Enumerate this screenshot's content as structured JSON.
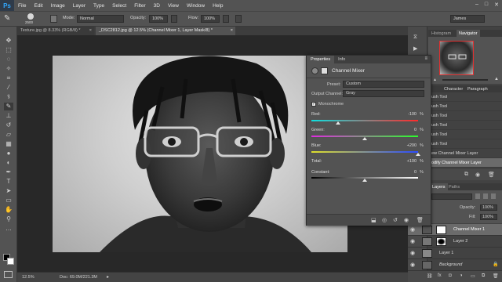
{
  "app": {
    "logo": "Ps",
    "user": "James"
  },
  "menu": [
    "File",
    "Edit",
    "Image",
    "Layer",
    "Type",
    "Select",
    "Filter",
    "3D",
    "View",
    "Window",
    "Help"
  ],
  "window_controls": [
    "–",
    "□",
    "✕"
  ],
  "options_bar": {
    "brush_size": "2500",
    "mode_label": "Mode:",
    "mode_value": "Normal",
    "opacity_label": "Opacity:",
    "opacity_value": "100%",
    "flow_label": "Flow:",
    "flow_value": "100%"
  },
  "tabs": [
    {
      "label": "Texture.jpg @ 8.33% (RGB/8) *",
      "close": "×"
    },
    {
      "label": "_DSC2812.jpg @ 12.5% (Channel Mixer 1, Layer Mask/8) *",
      "close": "×"
    }
  ],
  "status": {
    "zoom": "12.5%",
    "doc": "Doc: 69.0M/221.3M"
  },
  "properties": {
    "tabs": [
      "Properties",
      "Info"
    ],
    "title": "Channel Mixer",
    "preset_label": "Preset:",
    "preset_value": "Custom",
    "output_label": "Output Channel:",
    "output_value": "Gray",
    "monochrome_label": "Monochrome",
    "sliders": [
      {
        "label": "Red:",
        "value": "-100",
        "pos": 0.25,
        "track": "red"
      },
      {
        "label": "Green:",
        "value": "0",
        "pos": 0.5,
        "track": "green"
      },
      {
        "label": "Blue:",
        "value": "+200",
        "pos": 1.0,
        "track": "blue"
      }
    ],
    "total_label": "Total:",
    "total_value": "+100",
    "constant_label": "Constant:",
    "constant_value": "0",
    "constant_pos": 0.5,
    "pct": "%"
  },
  "right_panel": {
    "top_tabs": [
      "Histogram",
      "Navigator"
    ],
    "mid_tabs": [
      "Character",
      "Paragraph"
    ],
    "history": [
      "ush Tool",
      "ush Tool",
      "ush Tool",
      "ush Tool",
      "ush Tool",
      "ush Tool",
      "ew Channel Mixer Layer",
      "odify Channel Mixer Layer"
    ],
    "layers_tabs": [
      "Layers",
      "Paths"
    ],
    "opacity_label": "Opacity:",
    "opacity_value": "100%",
    "fill_label": "Fill:",
    "fill_value": "100%",
    "layers": [
      {
        "name": "Channel Mixer 1",
        "italic": false
      },
      {
        "name": "Layer 2",
        "italic": false
      },
      {
        "name": "Layer 1",
        "italic": false
      },
      {
        "name": "Background",
        "italic": true
      }
    ]
  }
}
